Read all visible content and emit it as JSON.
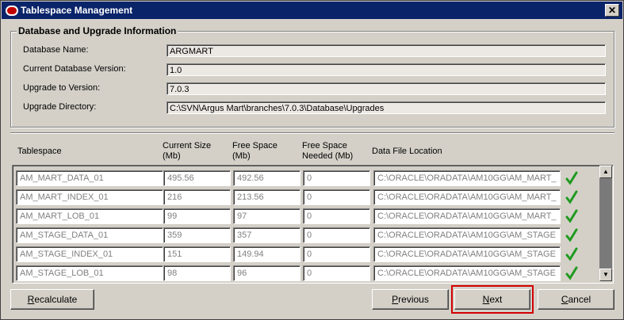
{
  "window": {
    "title": "Tablespace Management",
    "close_glyph": "✕"
  },
  "info_group": {
    "title": "Database and Upgrade Information",
    "fields": [
      {
        "label": "Database Name:",
        "value": "ARGMART"
      },
      {
        "label": "Current Database Version:",
        "value": "1.0"
      },
      {
        "label": "Upgrade to Version:",
        "value": "7.0.3"
      },
      {
        "label": "Upgrade Directory:",
        "value": "C:\\SVN\\Argus Mart\\branches\\7.0.3\\Database\\Upgrades"
      }
    ]
  },
  "grid": {
    "headers": {
      "tablespace": "Tablespace",
      "current_size_1": "Current Size",
      "current_size_2": "(Mb)",
      "free_space_1": "Free Space",
      "free_space_2": "(Mb)",
      "needed_1": "Free Space",
      "needed_2": "Needed (Mb)",
      "location": "Data File Location"
    },
    "rows": [
      {
        "tablespace": "AM_MART_DATA_01",
        "current": "495.56",
        "free": "492.56",
        "needed": "0",
        "location": "C:\\ORACLE\\ORADATA\\AM10GG\\AM_MART_",
        "status": "ok"
      },
      {
        "tablespace": "AM_MART_INDEX_01",
        "current": "216",
        "free": "213.56",
        "needed": "0",
        "location": "C:\\ORACLE\\ORADATA\\AM10GG\\AM_MART_",
        "status": "ok"
      },
      {
        "tablespace": "AM_MART_LOB_01",
        "current": "99",
        "free": "97",
        "needed": "0",
        "location": "C:\\ORACLE\\ORADATA\\AM10GG\\AM_MART_",
        "status": "ok"
      },
      {
        "tablespace": "AM_STAGE_DATA_01",
        "current": "359",
        "free": "357",
        "needed": "0",
        "location": "C:\\ORACLE\\ORADATA\\AM10GG\\AM_STAGE",
        "status": "ok"
      },
      {
        "tablespace": "AM_STAGE_INDEX_01",
        "current": "151",
        "free": "149.94",
        "needed": "0",
        "location": "C:\\ORACLE\\ORADATA\\AM10GG\\AM_STAGE",
        "status": "ok"
      },
      {
        "tablespace": "AM_STAGE_LOB_01",
        "current": "98",
        "free": "96",
        "needed": "0",
        "location": "C:\\ORACLE\\ORADATA\\AM10GG\\AM_STAGE",
        "status": "ok"
      }
    ]
  },
  "buttons": {
    "recalculate_first": "R",
    "recalculate_rest": "ecalculate",
    "previous_first": "P",
    "previous_rest": "revious",
    "next_first": "N",
    "next_rest": "ext",
    "cancel_first": "C",
    "cancel_rest": "ancel"
  },
  "colors": {
    "titlebar": "#0a246a",
    "check_icon": "#1f9a1f",
    "highlight_border": "#d20000"
  }
}
